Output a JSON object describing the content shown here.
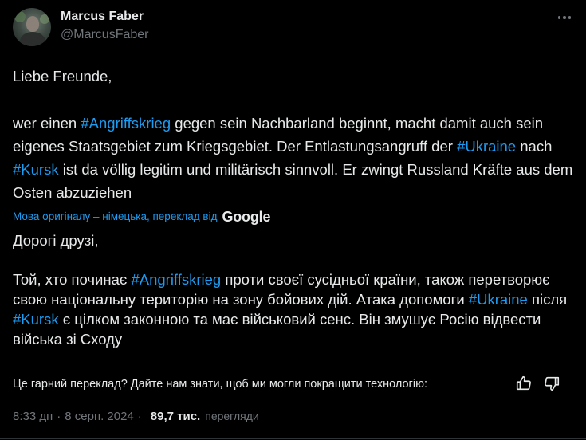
{
  "author": {
    "display_name": "Marcus Faber",
    "handle": "@MarcusFaber"
  },
  "original": {
    "greeting": "Liebe Freunde,",
    "body": [
      {
        "t": "wer einen "
      },
      {
        "t": "#Angriffskrieg",
        "tag": true
      },
      {
        "t": " gegen sein Nachbarland beginnt, macht damit auch sein eigenes Staatsgebiet zum Kriegsgebiet. Der Entlastungsangruff der "
      },
      {
        "t": "#Ukraine",
        "tag": true
      },
      {
        "t": " nach "
      },
      {
        "t": "#Kursk",
        "tag": true
      },
      {
        "t": " ist da völlig legitim und militärisch sinnvoll. Er zwingt Russland Kräfte aus dem Osten abzuziehen"
      }
    ]
  },
  "translation_notice": {
    "label": "Мова оригіналу – німецька, переклад від",
    "provider": "Google"
  },
  "translated": {
    "greeting": "Дорогі друзі,",
    "body": [
      {
        "t": "Той, хто починає "
      },
      {
        "t": "#Angriffskrieg",
        "tag": true
      },
      {
        "t": " проти своєї сусідньої країни, також перетворює свою національну територію на зону бойових дій. Атака допомоги "
      },
      {
        "t": "#Ukraine",
        "tag": true
      },
      {
        "t": " після "
      },
      {
        "t": "#Kursk",
        "tag": true
      },
      {
        "t": " є цілком законною та має військовий сенс. Він змушує Росію відвести війська зі Сходу"
      }
    ]
  },
  "feedback": {
    "question": "Це гарний переклад? Дайте нам знати, щоб ми могли покращити технологію:"
  },
  "meta": {
    "time": "8:33 дп",
    "separator": "·",
    "date": "8 серп. 2024",
    "separator2": "·",
    "views_count": "89,7 тис.",
    "views_label": "перегляди"
  },
  "colors": {
    "background": "#000000",
    "text": "#e7e9ea",
    "muted": "#71767b",
    "link": "#1d9bf0"
  },
  "icons": {
    "more": "more-icon",
    "thumb_up": "thumb-up-icon",
    "thumb_down": "thumb-down-icon"
  }
}
